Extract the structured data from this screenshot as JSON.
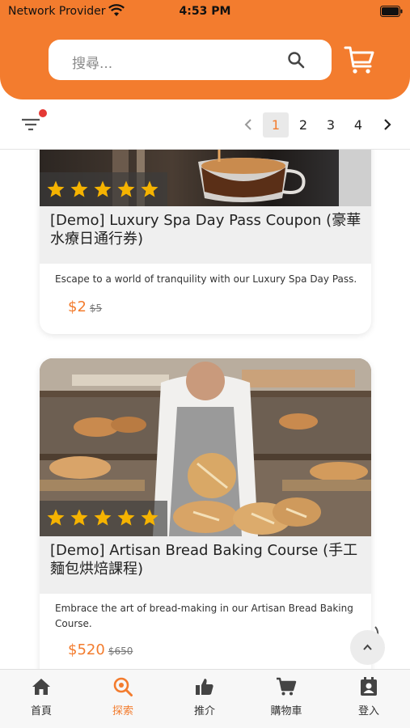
{
  "status_bar": {
    "carrier": "Network Provider",
    "time": "4:53 PM"
  },
  "header": {
    "search_placeholder": "搜尋...",
    "accent_color": "#f37c2e"
  },
  "toolbar": {
    "pages": [
      "1",
      "2",
      "3",
      "4"
    ],
    "current_page": "1"
  },
  "products": [
    {
      "title": "[Demo] Luxury Spa Day Pass Coupon (豪華水療日通行券)",
      "description": "Escape to a world of tranquility with our Luxury Spa Day Pass.",
      "price": "$2",
      "original_price": "$5",
      "rating": 5
    },
    {
      "title": "[Demo] Artisan Bread Baking Course (手工麵包烘焙課程)",
      "description": "Embrace the art of bread-making in our Artisan Bread Baking Course.",
      "price": "$520",
      "original_price": "$650",
      "rating": 5
    }
  ],
  "bottom_nav": [
    {
      "label": "首頁",
      "icon": "home-icon"
    },
    {
      "label": "探索",
      "icon": "explore-icon",
      "active": true
    },
    {
      "label": "推介",
      "icon": "thumbs-up-icon"
    },
    {
      "label": "購物車",
      "icon": "cart-icon"
    },
    {
      "label": "登入",
      "icon": "login-icon"
    }
  ]
}
